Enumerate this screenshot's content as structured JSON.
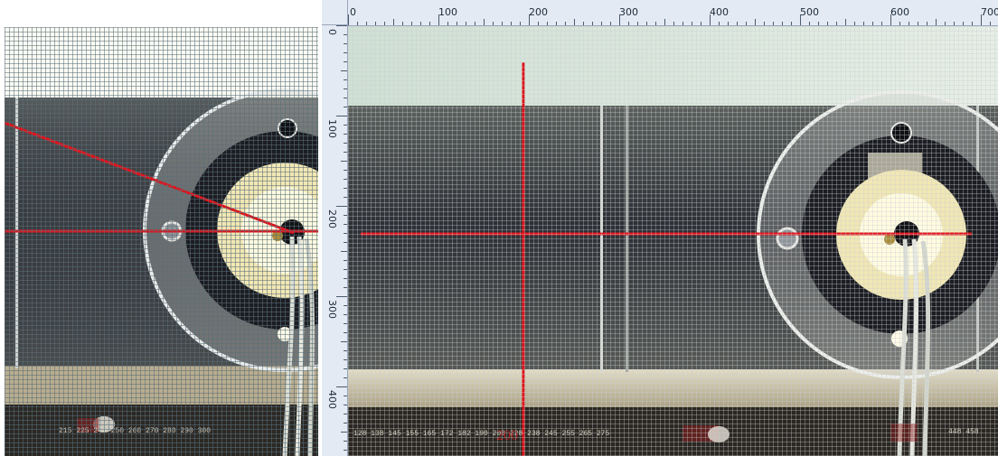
{
  "colors": {
    "crosshair": "#e0141c",
    "ruler_bg": "#e4eaf3",
    "grid": "#6e7e88",
    "acrylic_bg": "#3a3d42",
    "sky": "#d9e6dc",
    "floor": "#b9ad8f",
    "disk": "#e8ecea",
    "ring": "#1b1d22",
    "hub": "#f1e7b4"
  },
  "top_ruler": {
    "labels": [
      "0",
      "100",
      "200",
      "300",
      "400",
      "500",
      "600",
      "700"
    ]
  },
  "left_ruler": {
    "labels": [
      "0",
      "100",
      "200",
      "300",
      "400"
    ]
  },
  "bottom_scale": {
    "right_numbers": [
      "128",
      "138",
      "145",
      "155",
      "165",
      "172",
      "182",
      "190",
      "200",
      "228",
      "238",
      "245",
      "255",
      "265",
      "275"
    ],
    "right_big_number": "200",
    "right_end_numbers": [
      "448",
      "458"
    ],
    "left_numbers": [
      "215",
      "225",
      "240",
      "250",
      "260",
      "270",
      "280",
      "290",
      "300"
    ]
  },
  "icons": {
    "crosshair": "crosshair-icon",
    "bolt": "bolt-icon"
  }
}
